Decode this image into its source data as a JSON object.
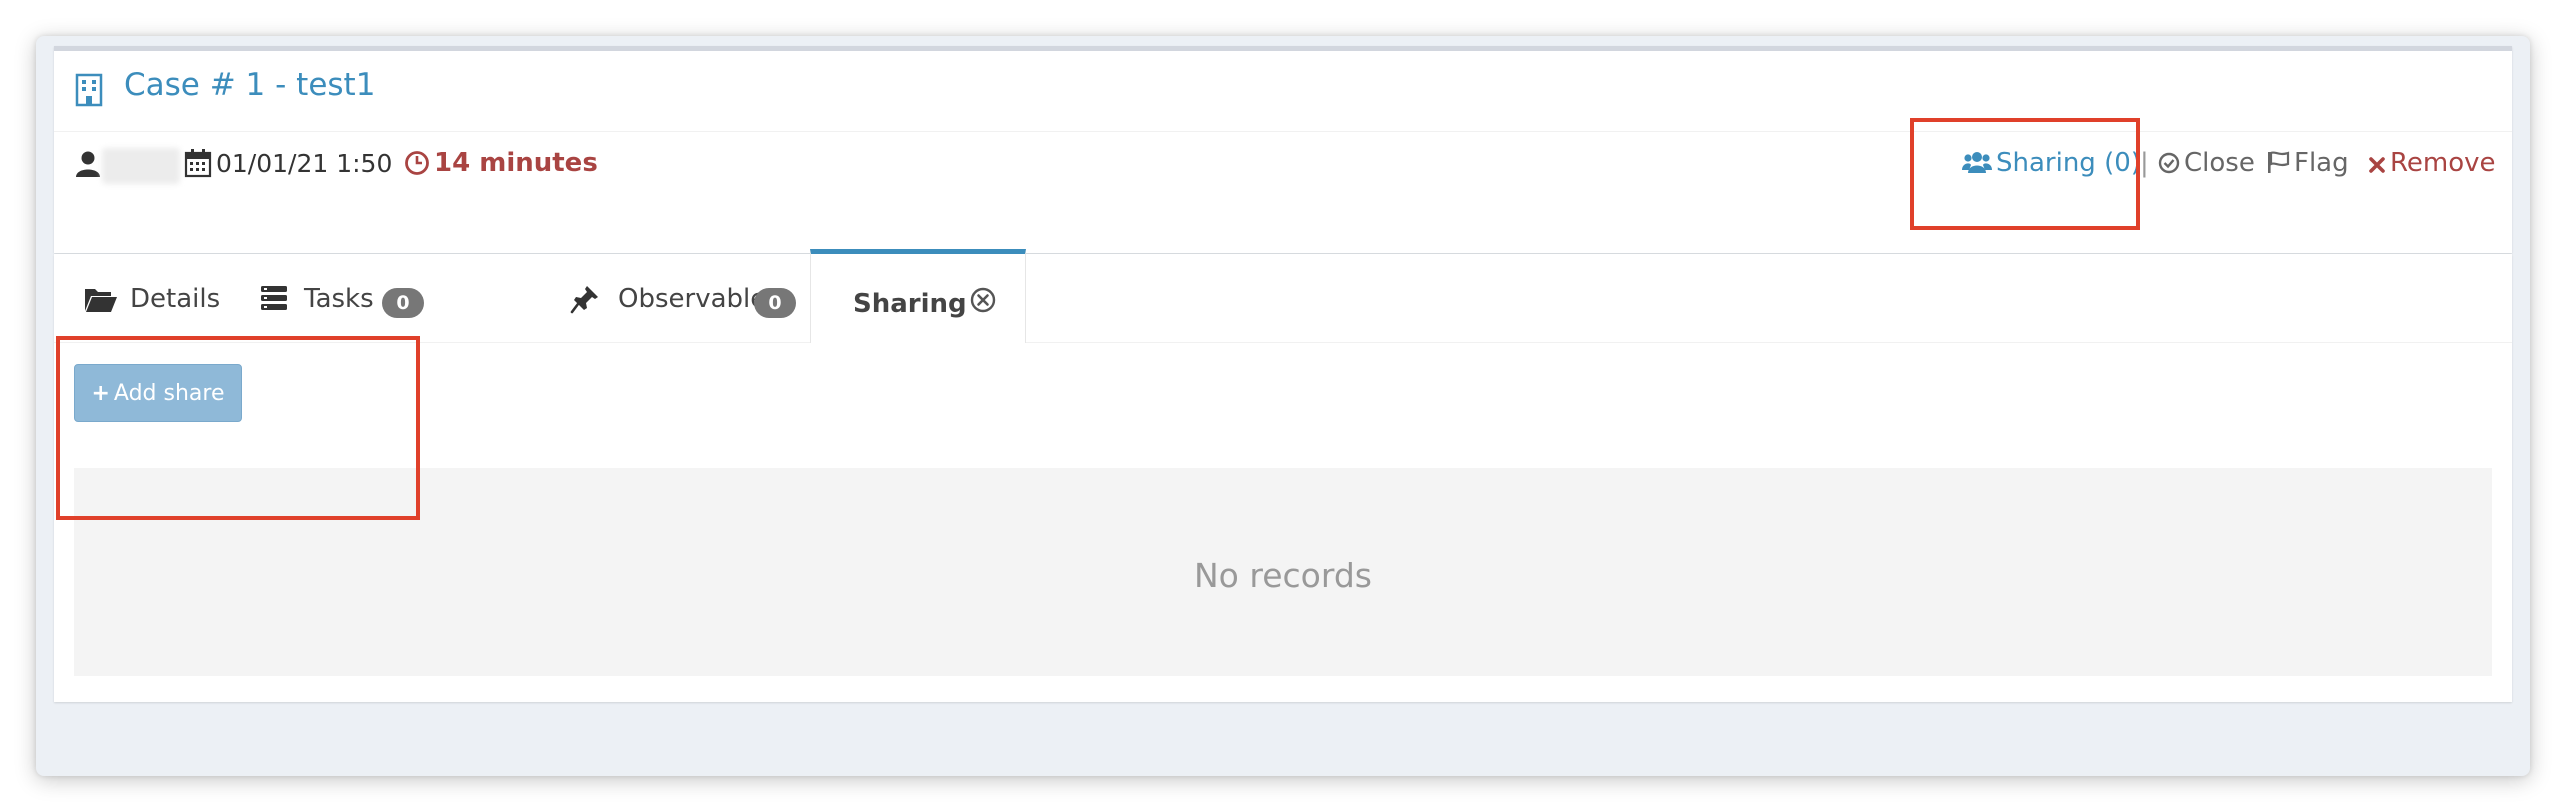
{
  "case": {
    "title": "Case # 1 - test1",
    "date": "01/01/21 1:50",
    "duration": "14 minutes"
  },
  "actions": {
    "sharing": "Sharing (0)",
    "separator": "|",
    "close": "Close",
    "flag": "Flag",
    "remove": "Remove"
  },
  "tabs": [
    {
      "label": "Details",
      "icon": "folder-open-icon"
    },
    {
      "label": "Tasks",
      "count": "0",
      "icon": "tasks-icon"
    },
    {
      "label": "Observables",
      "count": "0",
      "icon": "pin-icon"
    },
    {
      "label": "Sharing",
      "icon": "close-circle-icon",
      "active": true
    }
  ],
  "sharing_panel": {
    "add_button": "Add share",
    "empty_text": "No records"
  },
  "colors": {
    "link": "#3c8dbc",
    "danger": "#a94442",
    "annotation": "#e0402a",
    "button": "#8fb9d8"
  }
}
